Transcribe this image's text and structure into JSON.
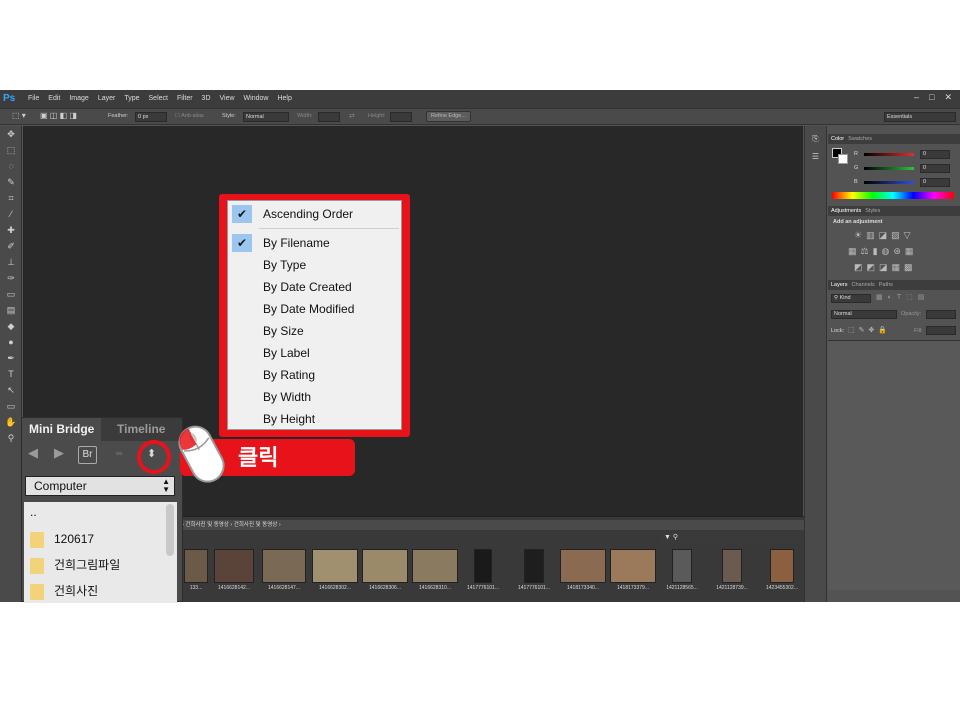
{
  "app": {
    "logo": "Ps",
    "menus": [
      "File",
      "Edit",
      "Image",
      "Layer",
      "Type",
      "Select",
      "Filter",
      "3D",
      "View",
      "Window",
      "Help"
    ],
    "window_controls": [
      "–",
      "□",
      "✕"
    ]
  },
  "options": {
    "feather_label": "Feather:",
    "feather_value": "0 px",
    "antialias": "Anti-alias",
    "style_label": "Style:",
    "style_value": "Normal",
    "width_label": "Width:",
    "height_label": "Height:",
    "refine_edge": "Refine Edge...",
    "workspace": "Essentials"
  },
  "color_panel": {
    "tabs": [
      "Color",
      "Swatches"
    ],
    "channels": [
      {
        "label": "R",
        "value": "0",
        "color": "#e03030"
      },
      {
        "label": "G",
        "value": "0",
        "color": "#30c040"
      },
      {
        "label": "B",
        "value": "0",
        "color": "#3050e0"
      }
    ]
  },
  "adjustments_panel": {
    "tabs": [
      "Adjustments",
      "Styles"
    ],
    "title": "Add an adjustment"
  },
  "layers_panel": {
    "tabs": [
      "Layers",
      "Channels",
      "Paths"
    ],
    "kind": "Kind",
    "blend_mode": "Normal",
    "opacity_label": "Opacity:",
    "lock_label": "Lock:",
    "fill_label": "Fill:"
  },
  "filmstrip": {
    "path": "› 건희사진 및 동영상 › 건희사진 및 동영상 ›",
    "captions": [
      "133...",
      "1416628142...",
      "1416628147...",
      "1416628302...",
      "1416628306...",
      "1416628310...",
      "1417776101...",
      "1417776101...",
      "1418173340...",
      "1418173379...",
      "1421128565...",
      "1421128739...",
      "1423455302..."
    ]
  },
  "mini_bridge": {
    "tabs": [
      "Mini Bridge",
      "Timeline"
    ],
    "br_label": "Br",
    "location": "Computer",
    "items": [
      "..",
      "120617",
      "건희그림파일",
      "건희사진"
    ]
  },
  "sort_menu": {
    "items": [
      {
        "label": "Ascending Order",
        "checked": true
      },
      {
        "label": "By Filename",
        "checked": true
      },
      {
        "label": "By Type",
        "checked": false
      },
      {
        "label": "By Date Created",
        "checked": false
      },
      {
        "label": "By Date Modified",
        "checked": false
      },
      {
        "label": "By Size",
        "checked": false
      },
      {
        "label": "By Label",
        "checked": false
      },
      {
        "label": "By Rating",
        "checked": false
      },
      {
        "label": "By Width",
        "checked": false
      },
      {
        "label": "By Height",
        "checked": false
      }
    ],
    "check_glyph": "✔"
  },
  "annotation": {
    "click_label": "클릭",
    "accent_color": "#e8131a"
  }
}
